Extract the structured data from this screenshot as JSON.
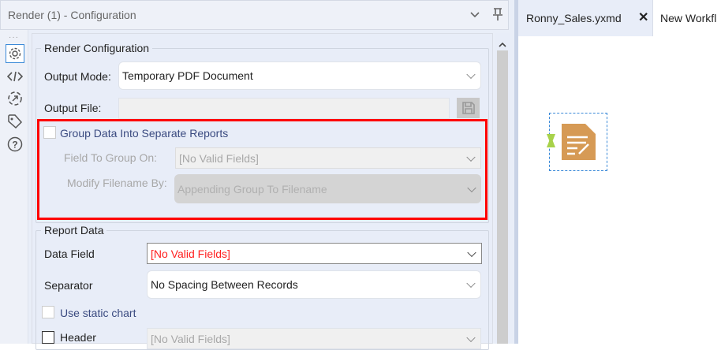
{
  "panel": {
    "title": "Render (1) - Configuration"
  },
  "render_config": {
    "legend": "Render Configuration",
    "output_mode_label": "Output Mode:",
    "output_mode_value": "Temporary PDF Document",
    "output_file_label": "Output File:",
    "output_file_value": "",
    "group_checkbox_label": "Group Data Into Separate Reports",
    "group_checked": false,
    "field_to_group_label": "Field To Group On:",
    "field_to_group_value": "[No Valid Fields]",
    "modify_filename_label": "Modify Filename By:",
    "modify_filename_value": "Appending Group To Filename"
  },
  "report_data": {
    "legend": "Report Data",
    "data_field_label": "Data Field",
    "data_field_value": "[No Valid Fields]",
    "separator_label": "Separator",
    "separator_value": "No Spacing Between Records",
    "static_chart_label": "Use static chart",
    "header_label": "Header",
    "header_value": "[No Valid Fields]"
  },
  "tabs": [
    {
      "label": "Ronny_Sales.yxmd"
    },
    {
      "label": "New Workfl"
    }
  ],
  "colors": {
    "highlight": "#ff0000",
    "error_text": "#ff2020",
    "tool_orange": "#d69a55",
    "anchor_green": "#a8d24a"
  }
}
